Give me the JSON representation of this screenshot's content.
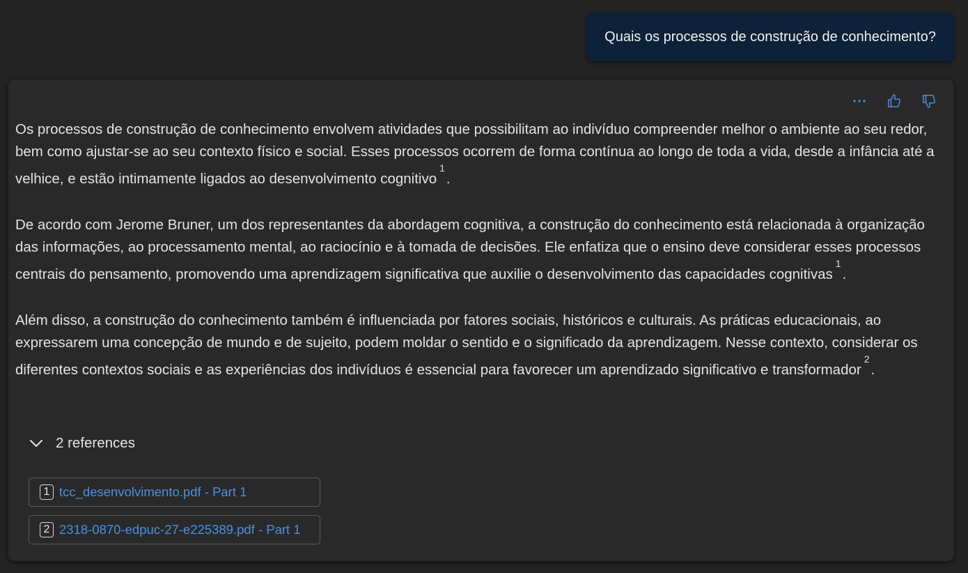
{
  "user_message": "Quais os processos de construção de conhecimento?",
  "answer": {
    "actions": {
      "more_icon": "more-horizontal-icon",
      "like_icon": "thumbs-up-icon",
      "dislike_icon": "thumbs-down-icon"
    },
    "paragraphs": [
      {
        "text": "Os processos de construção de conhecimento envolvem atividades que possibilitam ao indivíduo compreender melhor o ambiente ao seu redor, bem como ajustar-se ao seu contexto físico e social. Esses processos ocorrem de forma contínua ao longo de toda a vida, desde a infância até a velhice, e estão intimamente ligados ao desenvolvimento cognitivo",
        "citation": "1",
        "end": "."
      },
      {
        "text": "De acordo com Jerome Bruner, um dos representantes da abordagem cognitiva, a construção do conhecimento está relacionada à organização das informações, ao processamento mental, ao raciocínio e à tomada de decisões. Ele enfatiza que o ensino deve considerar esses processos centrais do pensamento, promovendo uma aprendizagem significativa que auxilie o desenvolvimento das capacidades cognitivas",
        "citation": "1",
        "end": "."
      },
      {
        "text": "Além disso, a construção do conhecimento também é influenciada por fatores sociais, históricos e culturais. As práticas educacionais, ao expressarem uma concepção de mundo e de sujeito, podem moldar o sentido e o significado da aprendizagem. Nesse contexto, considerar os diferentes contextos sociais e as experiências dos indivíduos é essencial para favorecer um aprendizado significativo e transformador",
        "citation": "2",
        "end": "."
      }
    ],
    "references": {
      "toggle_label": "2 references",
      "toggle_icon": "chevron-down-icon",
      "items": [
        {
          "number": "1",
          "label": "tcc_desenvolvimento.pdf - Part 1"
        },
        {
          "number": "2",
          "label": "2318-0870-edpuc-27-e225389.pdf - Part 1"
        }
      ]
    }
  },
  "colors": {
    "background": "#242424",
    "card": "#292929",
    "user_bubble": "#0d2138",
    "accent": "#4a90e2",
    "text": "#e3e3e3"
  }
}
